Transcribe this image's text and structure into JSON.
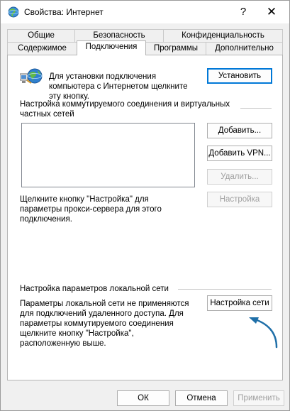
{
  "window": {
    "title": "Свойства: Интернет",
    "help": "?",
    "close": "✕"
  },
  "tabs_row1": [
    "Общие",
    "Безопасность",
    "Конфиденциальность"
  ],
  "tabs_row2": [
    "Содержимое",
    "Подключения",
    "Программы",
    "Дополнительно"
  ],
  "active_tab": "Подключения",
  "setup": {
    "text": "Для установки подключения компьютера с Интернетом щелкните эту кнопку.",
    "button": "Установить"
  },
  "dialup": {
    "heading": "Настройка коммутируемого соединения и виртуальных частных сетей",
    "add": "Добавить...",
    "add_vpn": "Добавить VPN...",
    "remove": "Удалить...",
    "settings": "Настройка",
    "settings_text": "Щелкните кнопку \"Настройка\" для параметры прокси-сервера для этого подключения."
  },
  "lan": {
    "heading": "Настройка параметров локальной сети",
    "text": "Параметры локальной сети не применяются для подключений удаленного доступа. Для параметры коммутируемого соединения щелкните кнопку \"Настройка\", расположенную выше.",
    "button": "Настройка сети"
  },
  "footer": {
    "ok": "ОК",
    "cancel": "Отмена",
    "apply": "Применить"
  },
  "colors": {
    "accent": "#0078d7",
    "annotation_arrow": "#1f6fa8"
  }
}
